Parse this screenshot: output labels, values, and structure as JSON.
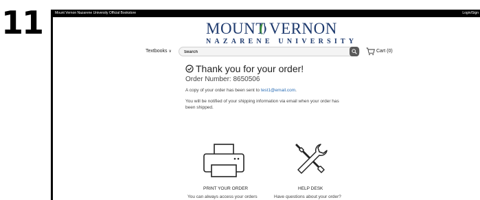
{
  "step_number": "11",
  "topbar": {
    "store_name": "Mount Vernon Nazarene University Official Bookstore",
    "login_label": "Login/Sign"
  },
  "logo": {
    "line1_word1": "MOUNT",
    "line1_word2": "VERNON",
    "line2": "NAZARENE UNIVERSITY",
    "icon": "leaf-flame-icon"
  },
  "nav": {
    "textbooks_label": "Textbooks",
    "textbooks_icon": "chevron-down-icon"
  },
  "search": {
    "placeholder": "Search",
    "button_icon": "search-icon"
  },
  "cart": {
    "label": "Cart (0)",
    "icon": "cart-icon"
  },
  "confirmation": {
    "icon": "check-circle-icon",
    "title": "Thank you for your order!",
    "order_number_text": "Order Number: 8650506",
    "copy_prefix": "A copy of your order has been sent to ",
    "email": "test1@email.com",
    "copy_suffix": ".",
    "shipping_note": "You will be notified of your shipping information via email when your order has been shipped."
  },
  "actions": {
    "print": {
      "icon": "printer-icon",
      "label": "PRINT YOUR ORDER",
      "subtext": "You can always access your orders"
    },
    "help": {
      "icon": "tools-icon",
      "label": "HELP DESK",
      "subtext": "Have questions about your order?"
    }
  },
  "colors": {
    "brand_navy": "#1e3a6e",
    "brand_green": "#3a8a3f",
    "link_blue": "#2a6db5",
    "topbar_bg": "#000000"
  }
}
